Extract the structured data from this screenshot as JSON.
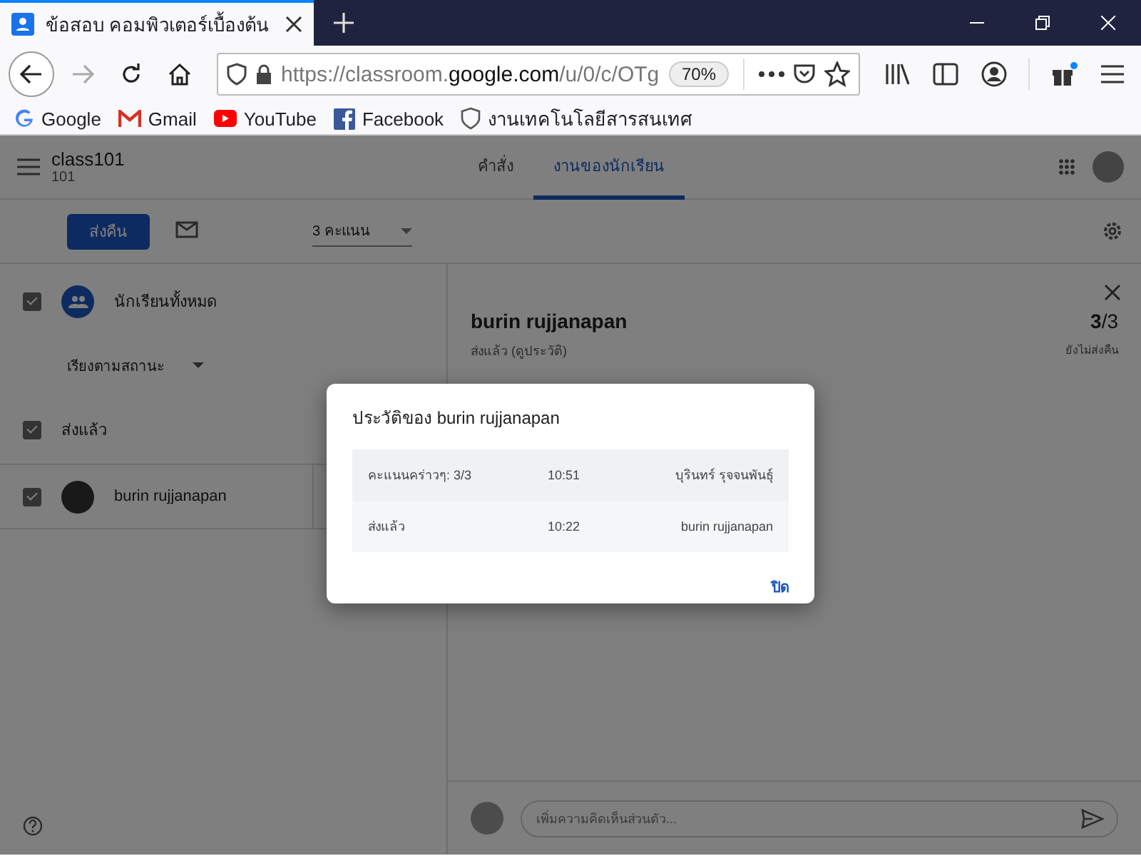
{
  "browser": {
    "tab": {
      "title": "ข้อสอบ คอมพิวเตอร์เบื้องต้น"
    },
    "url": {
      "prefix": "https://classroom.",
      "domain": "google.com",
      "path": "/u/0/c/OTg"
    },
    "zoom": "70%",
    "bookmarks": [
      {
        "label": "Google",
        "kind": "google"
      },
      {
        "label": "Gmail",
        "kind": "gmail"
      },
      {
        "label": "YouTube",
        "kind": "youtube"
      },
      {
        "label": "Facebook",
        "kind": "facebook"
      },
      {
        "label": "งานเทคโนโลยีสารสนเทศ",
        "kind": "shield"
      }
    ]
  },
  "app": {
    "class_name": "class101",
    "class_section": "101",
    "tabs": [
      {
        "label": "คำสั่ง",
        "selected": false
      },
      {
        "label": "งานของนักเรียน",
        "selected": true
      }
    ]
  },
  "toolbar": {
    "return_button": "ส่งคืน",
    "points": "3 คะแนน"
  },
  "students": {
    "all": {
      "label": "นักเรียนทั้งหมด",
      "checked": true
    },
    "sort": "เรียงตามสถานะ",
    "groups": [
      {
        "label": "ส่งแล้ว",
        "checked": true,
        "students": [
          {
            "name": "burin rujjanapan",
            "checked": true
          }
        ]
      }
    ]
  },
  "detail": {
    "name": "burin rujjanapan",
    "status": "ส่งแล้ว (ดูประวัติ)",
    "score": "**3**/3",
    "score_note": "ยังไม่ส่งคืน",
    "comment_placeholder": "เพิ่มความคิดเห็นส่วนตัว..."
  },
  "dialog": {
    "title": "ประวัติของ burin rujjanapan",
    "rows": [
      {
        "event": "คะแนนคร่าวๆ: 3/3",
        "time": "10:51",
        "by": "บุรินทร์ รุจจนพันธุ์"
      },
      {
        "event": "ส่งแล้ว",
        "time": "10:22",
        "by": "burin rujjanapan"
      }
    ],
    "close": "ปิด"
  }
}
